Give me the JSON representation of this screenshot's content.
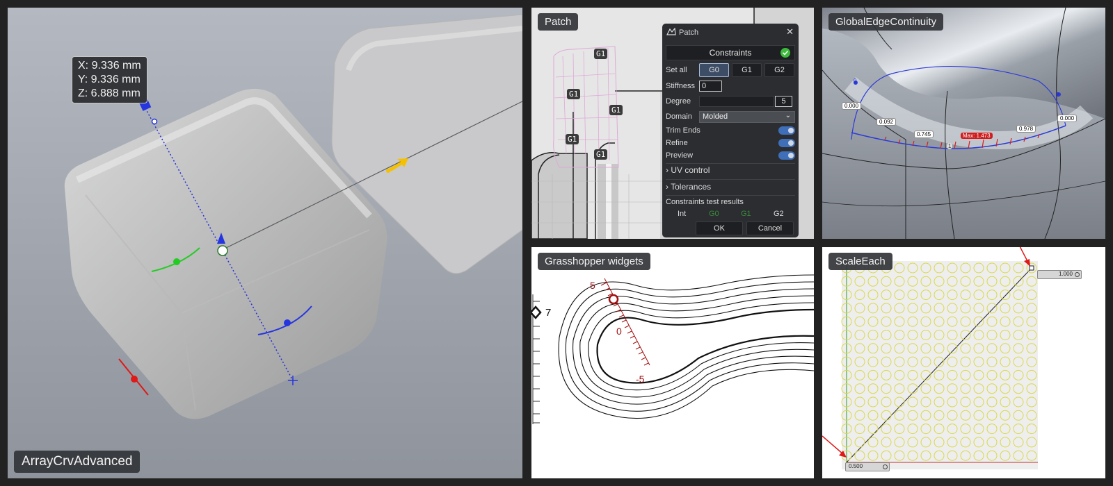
{
  "panels": {
    "array": {
      "title": "ArrayCrvAdvanced",
      "coords": {
        "x": "X: 9.336 mm",
        "y": "Y: 9.336 mm",
        "z": "Z: 6.888 mm"
      }
    },
    "patch": {
      "title": "Patch",
      "tags": [
        "G1",
        "G1",
        "G1",
        "G1",
        "G1"
      ],
      "dialog": {
        "title": "Patch",
        "close": "✕",
        "constraints_label": "Constraints",
        "set_all_label": "Set all",
        "set_all_options": [
          "G0",
          "G1",
          "G2"
        ],
        "set_all_selected": "G0",
        "stiffness_label": "Stiffness",
        "stiffness_value": "0",
        "degree_label": "Degree",
        "degree_value": "5",
        "domain_label": "Domain",
        "domain_value": "Molded",
        "trim_ends_label": "Trim Ends",
        "refine_label": "Refine",
        "preview_label": "Preview",
        "uv_control_label": "UV control",
        "tolerances_label": "Tolerances",
        "results_label": "Constraints test results",
        "results": [
          "Int",
          "G0",
          "G1",
          "G2"
        ],
        "ok_label": "OK",
        "cancel_label": "Cancel"
      }
    },
    "gec": {
      "title": "GlobalEdgeContinuity",
      "values": [
        "0.000",
        "0.092",
        "0.745",
        "Max: 1.473",
        "0.978",
        "0.000"
      ],
      "end_markers": [
        "0",
        "1",
        "2"
      ]
    },
    "gh": {
      "title": "Grasshopper widgets",
      "ruler_labels": [
        "5",
        "0",
        "-5"
      ],
      "slider_value": "7"
    },
    "scale": {
      "title": "ScaleEach",
      "top_value": "1.000",
      "bottom_value": "0.500"
    }
  },
  "colors": {
    "panel_label_bg": "#323438",
    "toggle_on": "#3f6fb8",
    "gh_red": "#a01010",
    "max_badge": "#d01c1c",
    "circle_yellow": "#d9d94a"
  }
}
